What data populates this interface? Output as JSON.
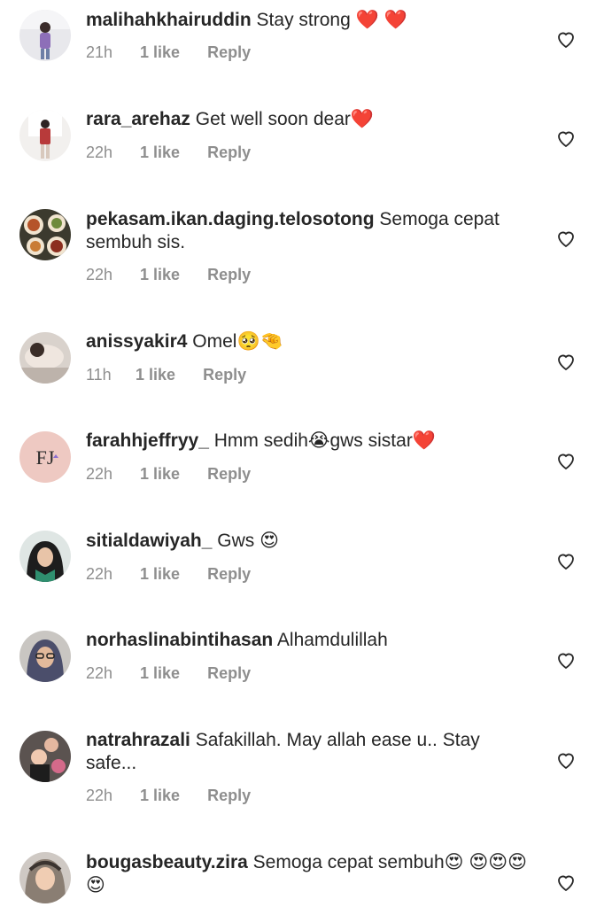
{
  "comments": [
    {
      "username": "malihahkhairuddin",
      "text": "Stay strong ❤️ ❤️",
      "time": "21h",
      "likes": "1 like",
      "reply": "Reply",
      "avatar": "avatar-woman-purple"
    },
    {
      "username": "rara_arehaz",
      "text": "Get well soon dear❤️",
      "time": "22h",
      "likes": "1 like",
      "reply": "Reply",
      "avatar": "avatar-woman-standing"
    },
    {
      "username": "pekasam.ikan.daging.telosotong",
      "text": "Semoga cepat sembuh sis.",
      "time": "22h",
      "likes": "1 like",
      "reply": "Reply",
      "avatar": "avatar-food-plates"
    },
    {
      "username": "anissyakir4",
      "text": "Omel🥺🤏",
      "time": "11h",
      "likes": "1 like",
      "reply": "Reply",
      "avatar": "avatar-person-lying"
    },
    {
      "username": "farahhjeffryy_",
      "text": "Hmm sedih😭gws sistar❤️",
      "time": "22h",
      "likes": "1 like",
      "reply": "Reply",
      "avatar": "avatar-fj-monogram",
      "avatar_text": "FJ"
    },
    {
      "username": "sitialdawiyah_",
      "text": "Gws 😍",
      "time": "22h",
      "likes": "1 like",
      "reply": "Reply",
      "avatar": "avatar-woman-hijab"
    },
    {
      "username": "norhaslinabintihasan",
      "text": "Alhamdulillah",
      "time": "22h",
      "likes": "1 like",
      "reply": "Reply",
      "avatar": "avatar-woman-glasses"
    },
    {
      "username": "natrahrazali",
      "text": "Safakillah. May allah ease u.. Stay safe...",
      "time": "22h",
      "likes": "1 like",
      "reply": "Reply",
      "avatar": "avatar-family"
    },
    {
      "username": "bougasbeauty.zira",
      "text": "Semoga cepat sembuh😍 😍😍😍😍",
      "time": "",
      "likes": "",
      "reply": "",
      "avatar": "avatar-woman-scarf"
    }
  ],
  "colors": {
    "text": "#262626",
    "meta": "#8e8e8e",
    "heart_outline": "#262626"
  },
  "icons": {
    "like": "heart-outline-icon"
  }
}
